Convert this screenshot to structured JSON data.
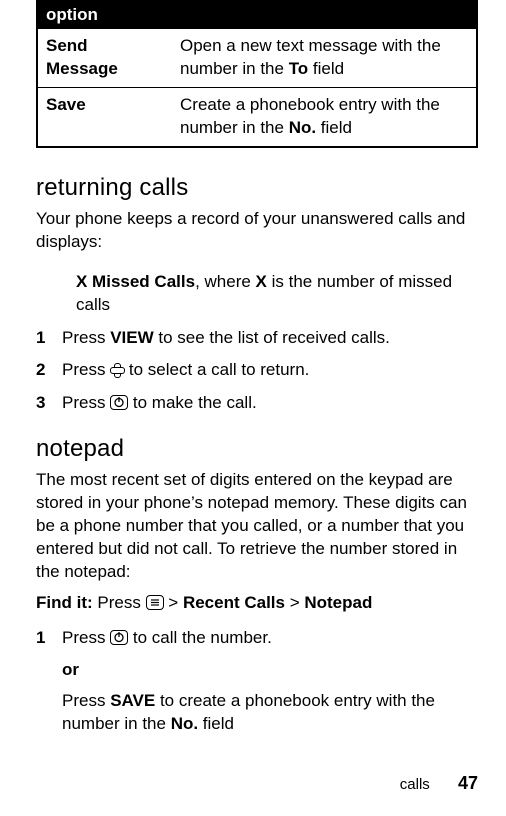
{
  "table": {
    "header": "option",
    "rows": [
      {
        "name": "Send Message",
        "desc_a": "Open a new text message with the number in the ",
        "desc_b": "To",
        "desc_c": " field"
      },
      {
        "name": "Save",
        "desc_a": "Create a phonebook entry with the number in the ",
        "desc_b": "No.",
        "desc_c": " field"
      }
    ]
  },
  "section1": {
    "title": "returning calls",
    "intro": "Your phone keeps a record of your unanswered calls and displays:",
    "missed_a": "X Missed Calls",
    "missed_b": ", where ",
    "missed_c": "X",
    "missed_d": " is the number of missed calls",
    "step1_a": "Press ",
    "step1_b": "VIEW",
    "step1_c": " to see the list of received calls.",
    "step2_a": "Press ",
    "step2_b": " to select a call to return.",
    "step3_a": "Press ",
    "step3_b": " to make the call."
  },
  "section2": {
    "title": "notepad",
    "intro": "The most recent set of digits entered on the keypad are stored in your phone’s notepad memory. These digits can be a phone number that you called, or a number that you entered but did not call. To retrieve the number stored in the notepad:",
    "findit_label": "Find it:",
    "findit_a": " Press ",
    "findit_b": " > ",
    "findit_c": "Recent Calls",
    "findit_d": " > ",
    "findit_e": "Notepad",
    "step1_a": "Press ",
    "step1_b": " to call the number.",
    "or": "or",
    "alt_a": "Press ",
    "alt_b": "SAVE",
    "alt_c": " to create a phonebook entry with the number in the ",
    "alt_d": "No.",
    "alt_e": " field"
  },
  "footer": {
    "section": "calls",
    "page": "47"
  },
  "nums": {
    "n1": "1",
    "n2": "2",
    "n3": "3"
  }
}
